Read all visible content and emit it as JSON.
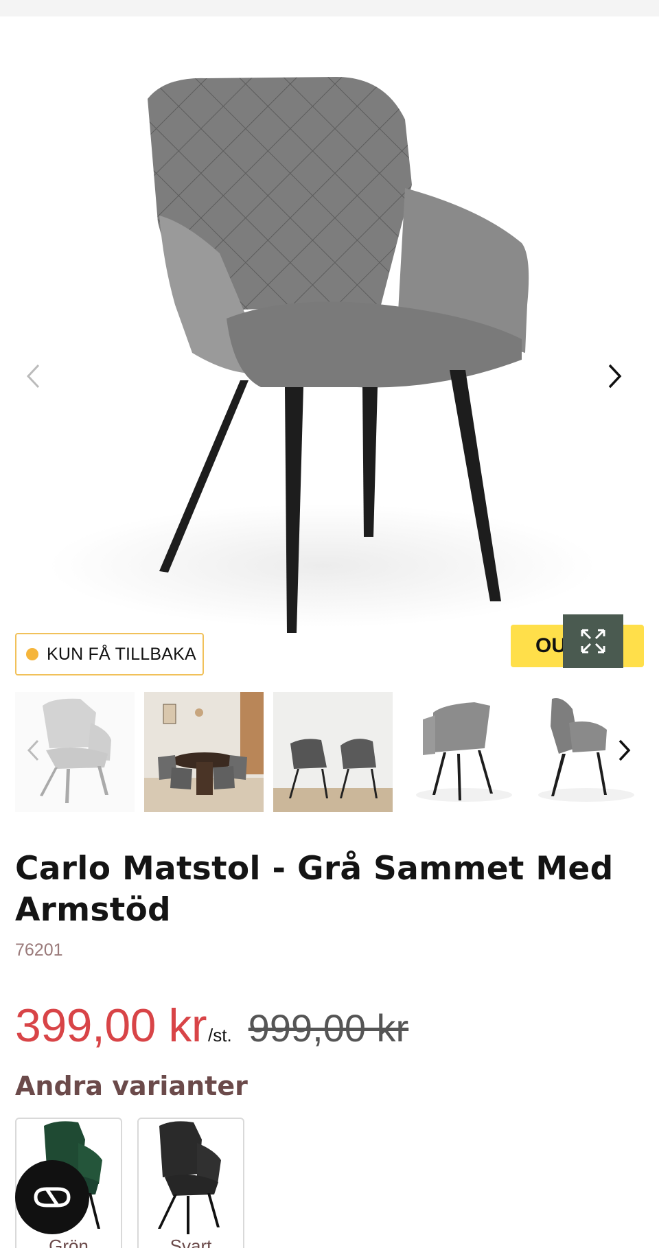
{
  "hero": {
    "image_alt": "Carlo Matstol grå sammet",
    "prev_icon": "chevron-left-icon",
    "next_icon": "chevron-right-icon"
  },
  "badges": {
    "stock": "KUN FÅ TILLBAKA",
    "stock_color": "#f5b53b",
    "outlet": "OUTLET",
    "outlet_color": "#ffdf4a"
  },
  "zoom": {
    "icon": "expand-icon",
    "color": "#4a5a50"
  },
  "thumbnails": [
    {
      "label": "Grå stol framifrån"
    },
    {
      "label": "Matsal med runt bord"
    },
    {
      "label": "Två stolar i rum"
    },
    {
      "label": "Stol bakifrån"
    },
    {
      "label": "Stol från sidan"
    }
  ],
  "product": {
    "title": "Carlo Matstol - Grå Sammet Med Armstöd",
    "sku": "76201"
  },
  "price": {
    "current": "399,00 kr",
    "unit": "/st.",
    "original": "999,00 kr",
    "current_color": "#d84447"
  },
  "variants": {
    "heading": "Andra varianter",
    "items": [
      {
        "label": "Grön",
        "color": "#1f4a33"
      },
      {
        "label": "Svart",
        "color": "#2a2a2a"
      }
    ]
  },
  "chat": {
    "icon": "chat-bubble-icon"
  }
}
